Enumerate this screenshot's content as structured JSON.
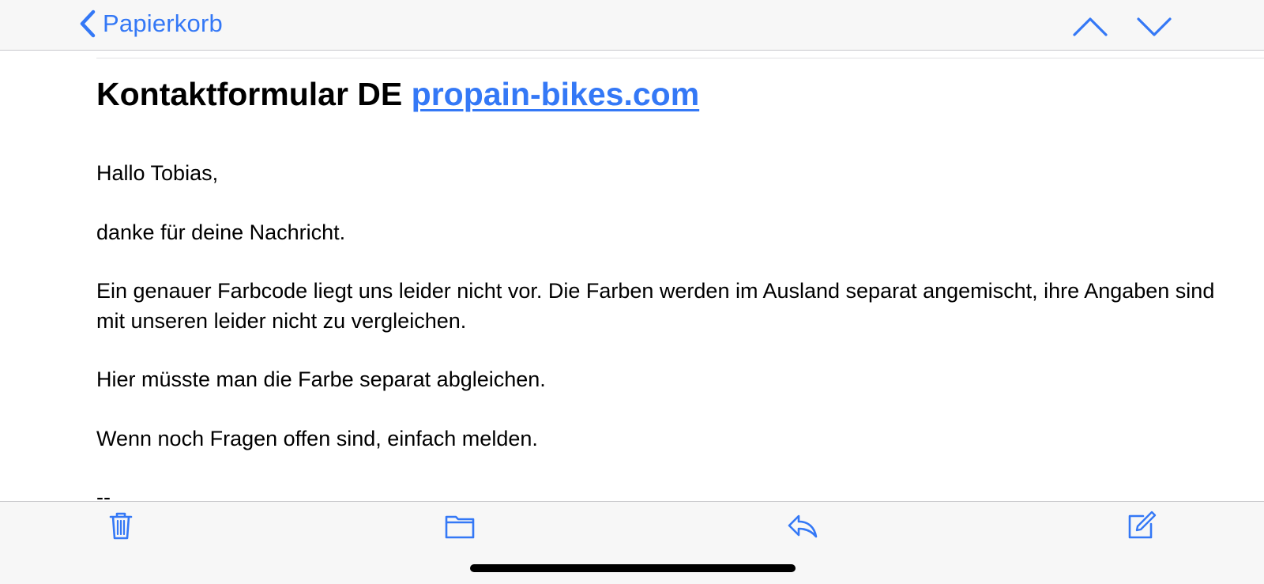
{
  "colors": {
    "accent": "#3478f6",
    "bar_background": "#f7f7f7",
    "text": "#000000",
    "home_indicator": "#000000"
  },
  "navbar": {
    "back_label": "Papierkorb",
    "back_icon": "chevron-left-icon",
    "previous_icon": "chevron-up-icon",
    "next_icon": "chevron-down-icon"
  },
  "email": {
    "subject_text": "Kontaktformular DE ",
    "subject_link": "propain-bikes.com",
    "body": [
      "Hallo Tobias,",
      "danke für deine Nachricht.",
      "Ein genauer Farbcode liegt uns leider nicht vor. Die Farben werden im Ausland separat angemischt, ihre Angaben sind mit unseren leider nicht zu vergleichen.",
      "Hier müsste man die Farbe separat abgleichen.",
      "Wenn noch Fragen offen sind, einfach melden.",
      "--"
    ]
  },
  "toolbar": {
    "icons": [
      "trash-icon",
      "folder-icon",
      "reply-icon",
      "compose-icon"
    ]
  }
}
